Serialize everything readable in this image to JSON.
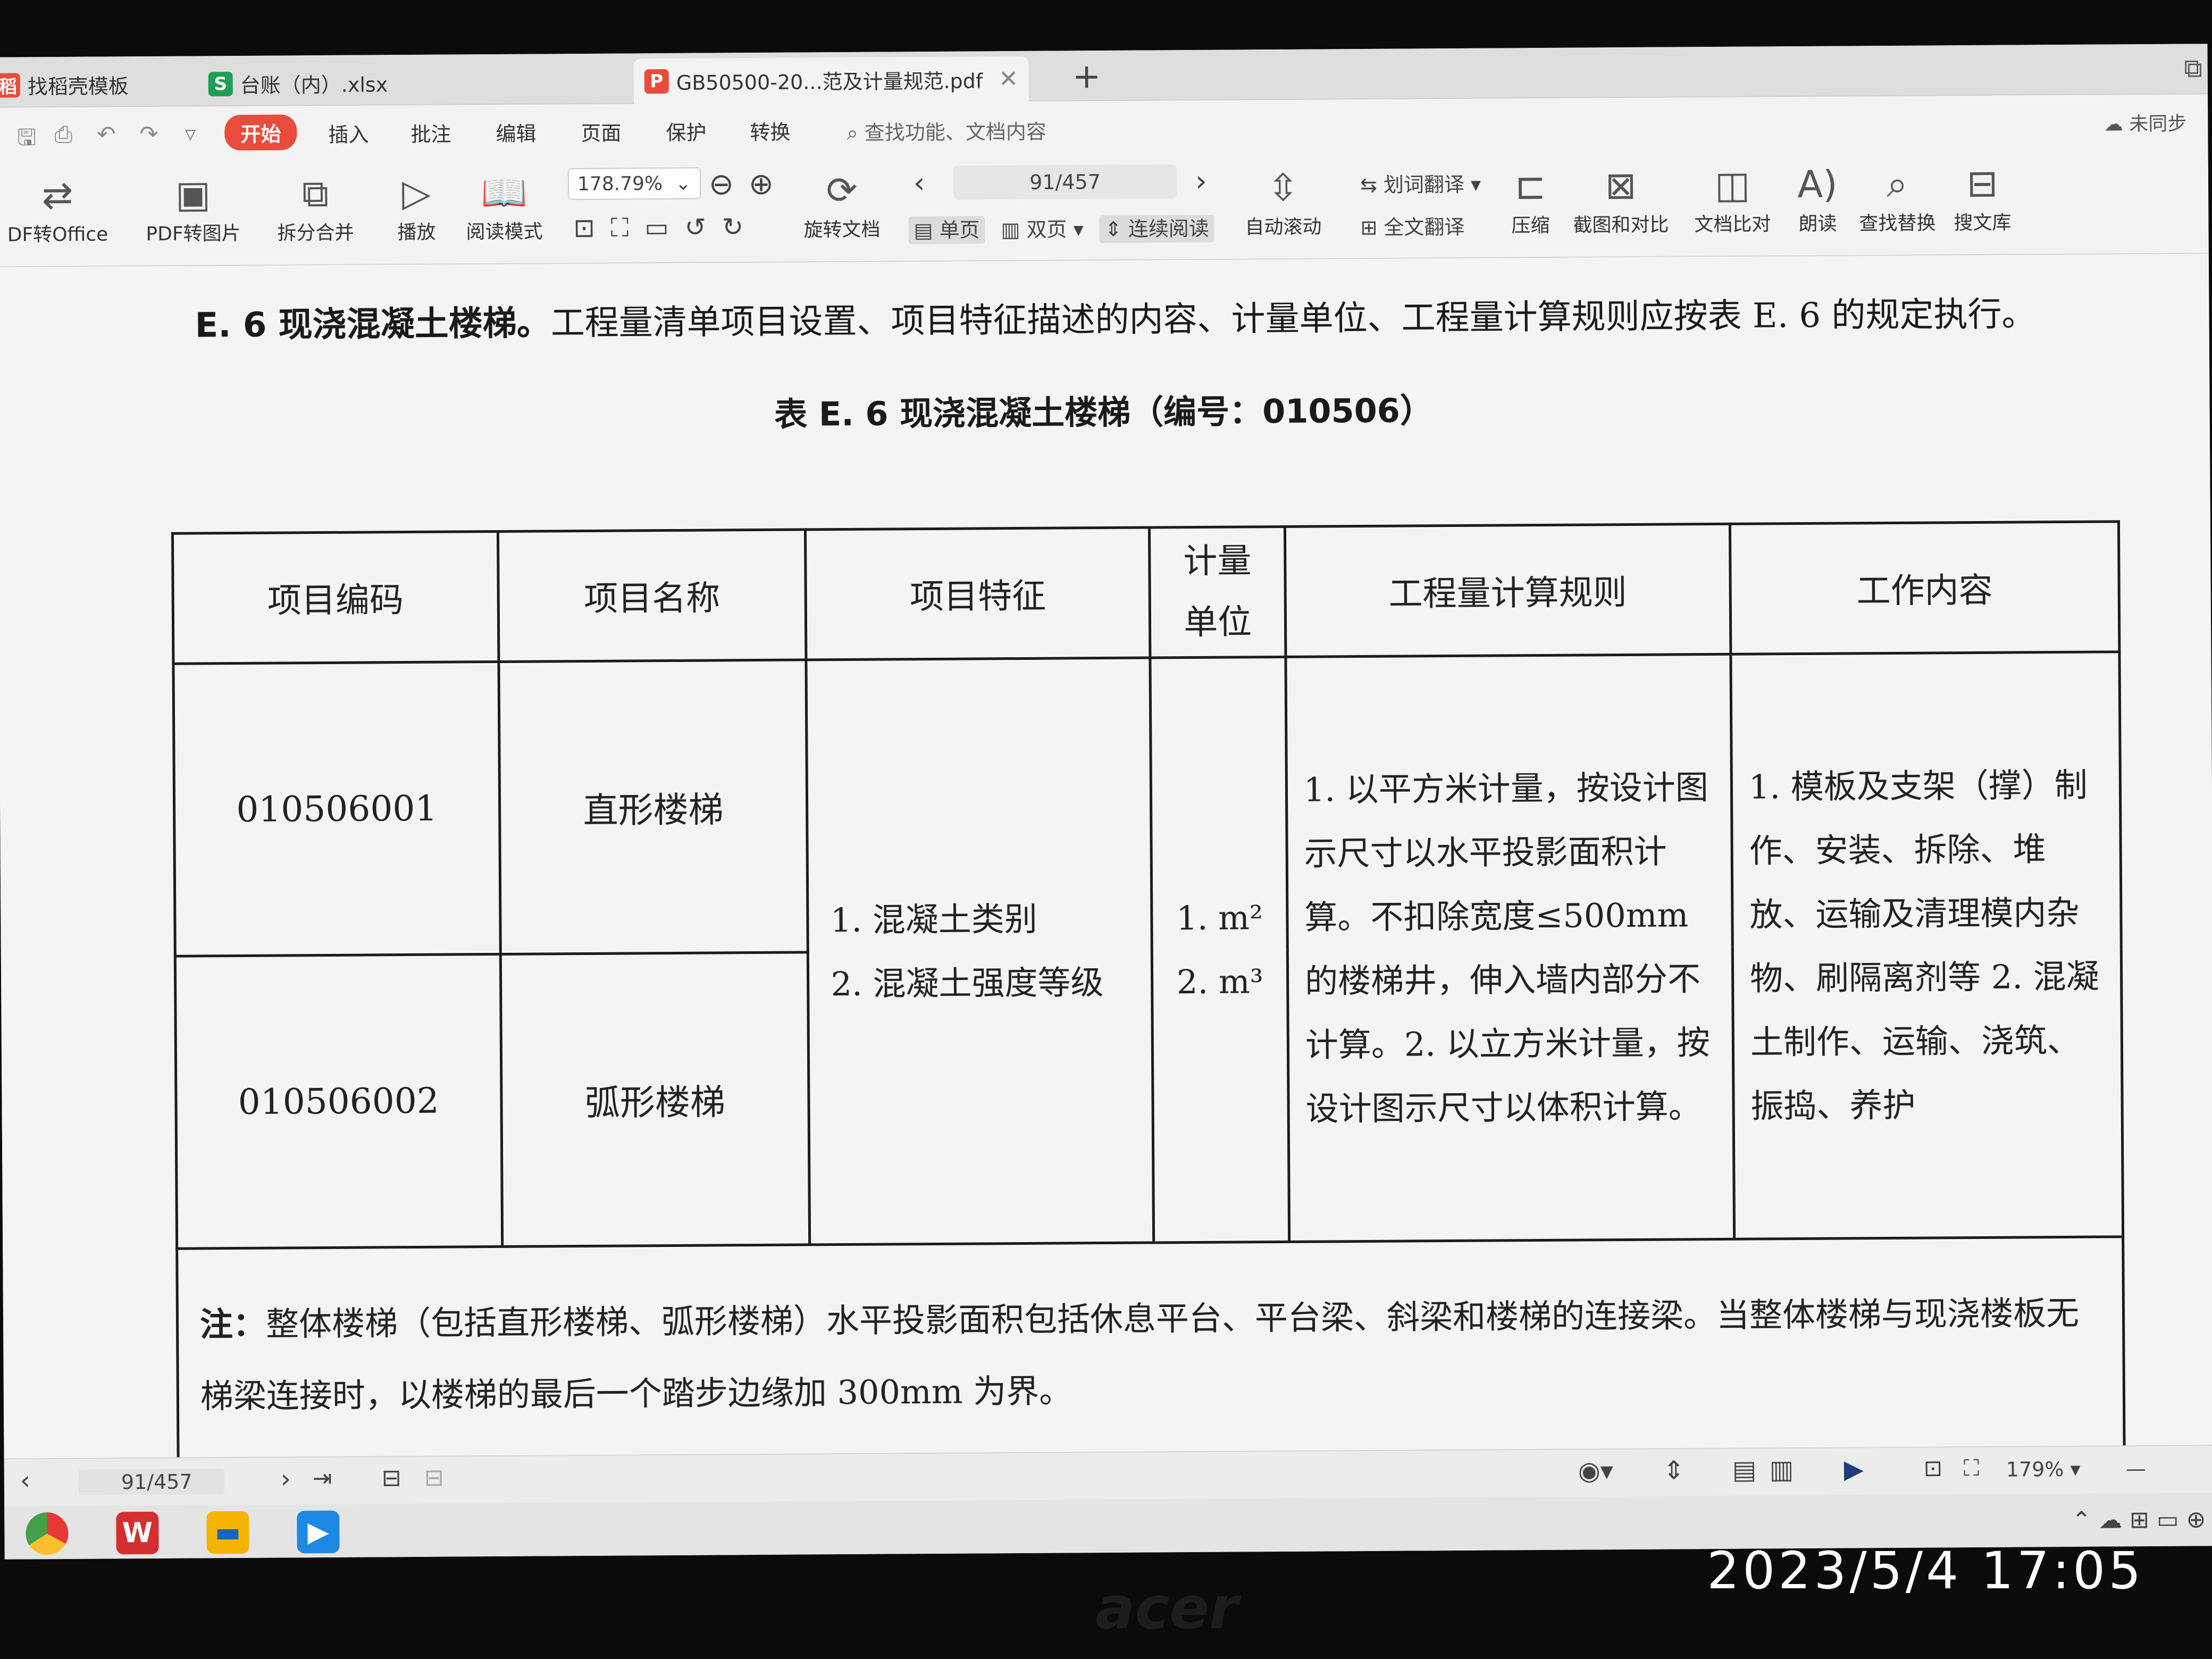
{
  "tabs": [
    {
      "label": "找稻壳模板",
      "icon": "docer-icon"
    },
    {
      "label": "台账（内）.xlsx",
      "icon": "spreadsheet-icon"
    },
    {
      "label": "GB50500-20...范及计量规范.pdf",
      "icon": "pdf-icon"
    }
  ],
  "menu": {
    "items": [
      "开始",
      "插入",
      "批注",
      "编辑",
      "页面",
      "保护",
      "转换"
    ],
    "search_placeholder": "查找功能、文档内容",
    "sync_status": "未同步"
  },
  "ribbon": {
    "pdf_to_office": "DF转Office",
    "pdf_to_image": "PDF转图片",
    "split_merge": "拆分合并",
    "play": "播放",
    "read_mode": "阅读模式",
    "zoom": "178.79%",
    "rotate": "旋转文档",
    "page_indicator": "91/457",
    "single_page": "单页",
    "double_page": "双页",
    "continuous": "连续阅读",
    "auto_scroll": "自动滚动",
    "word_translate": "划词翻译",
    "full_translate": "全文翻译",
    "compress": "压缩",
    "screenshot_compare": "截图和对比",
    "doc_compare": "文档比对",
    "read_aloud": "朗读",
    "find_replace": "查找替换",
    "library": "搜文库"
  },
  "document": {
    "heading_bold": "E. 6 现浇混凝土楼梯。",
    "heading_text": "工程量清单项目设置、项目特征描述的内容、计量单位、工程量计算规则应按表 E. 6 的规定执行。",
    "table_title": "表 E. 6 现浇混凝土楼梯（编号：010506）",
    "table": {
      "headers": [
        "项目编码",
        "项目名称",
        "项目特征",
        "计量单位",
        "工程量计算规则",
        "工作内容"
      ],
      "header_unit_line1": "计量",
      "header_unit_line2": "单位",
      "rows": [
        {
          "code": "010506001",
          "name": "直形楼梯"
        },
        {
          "code": "010506002",
          "name": "弧形楼梯"
        }
      ],
      "features": [
        "1. 混凝土类别",
        "2. 混凝土强度等级"
      ],
      "units": [
        "1. m²",
        "2. m³"
      ],
      "rules": "1. 以平方米计量，按设计图示尺寸以水平投影面积计算。不扣除宽度≤500mm的楼梯井，伸入墙内部分不计算。2. 以立方米计量，按设计图示尺寸以体积计算。",
      "work": "1. 模板及支架（撑）制作、安装、拆除、堆放、运输及清理模内杂物、刷隔离剂等 2. 混凝土制作、运输、浇筑、振捣、养护",
      "note_label": "注：",
      "note_text": "整体楼梯（包括直形楼梯、弧形楼梯）水平投影面积包括休息平台、平台梁、斜梁和楼梯的连接梁。当整体楼梯与现浇楼板无梯梁连接时，以楼梯的最后一个踏步边缘加 300mm 为界。"
    }
  },
  "statusbar": {
    "page": "91/457",
    "zoom": "179%"
  },
  "photo_timestamp": "2023/5/4 17:05",
  "monitor_brand": "acer"
}
